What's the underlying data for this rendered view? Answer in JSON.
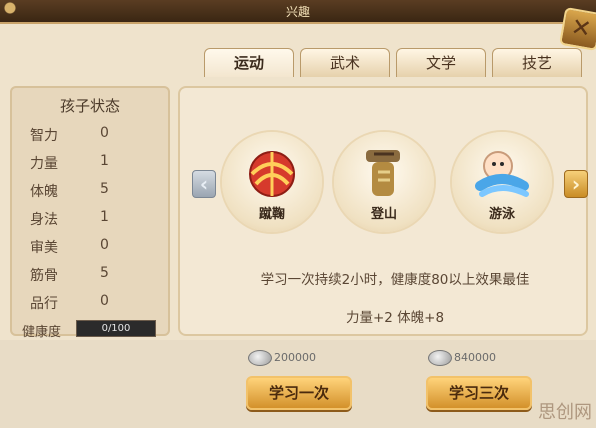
{
  "window": {
    "title": "兴趣",
    "close_icon": "close-x-icon"
  },
  "tabs": [
    {
      "label": "运动",
      "active": true
    },
    {
      "label": "武术",
      "active": false
    },
    {
      "label": "文学",
      "active": false
    },
    {
      "label": "技艺",
      "active": false
    }
  ],
  "child_status": {
    "title": "孩子状态",
    "stats": [
      {
        "label": "智力",
        "value": "0"
      },
      {
        "label": "力量",
        "value": "1"
      },
      {
        "label": "体魄",
        "value": "5"
      },
      {
        "label": "身法",
        "value": "1"
      },
      {
        "label": "审美",
        "value": "0"
      },
      {
        "label": "筋骨",
        "value": "5"
      },
      {
        "label": "品行",
        "value": "0"
      }
    ],
    "health": {
      "label": "健康度",
      "text": "0/100",
      "fraction": 0.0
    }
  },
  "activities": [
    {
      "label": "蹴鞠",
      "icon": "ball-icon"
    },
    {
      "label": "登山",
      "icon": "mountain-climbing-icon"
    },
    {
      "label": "游泳",
      "icon": "swimming-icon"
    }
  ],
  "description": "学习一次持续2小时，健康度80以上效果最佳",
  "bonuses": "力量+2   体魄+8",
  "actions": [
    {
      "cost": "200000",
      "label": "学习一次"
    },
    {
      "cost": "840000",
      "label": "学习三次"
    }
  ],
  "watermark": "思创网",
  "colors": {
    "gold": "#d3912b",
    "panel": "#e7d7bc",
    "text": "#5a4634"
  }
}
